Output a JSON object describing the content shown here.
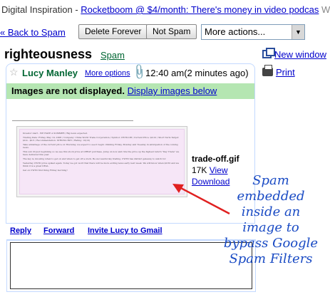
{
  "topbar": {
    "source": "Digital Inspiration",
    "separator": " - ",
    "link": "Rocketboom @ $4/month: There's money in video podcas",
    "tail": "W"
  },
  "toolbar": {
    "back": "« Back to Spam",
    "delete": "Delete Forever",
    "notspam": "Not Spam",
    "more_actions": "More actions..."
  },
  "subject": {
    "title": "righteousness",
    "label": "Spam",
    "new_window": "New window",
    "print": "Print"
  },
  "message": {
    "sender": "Lucy Manley",
    "more_options": "More options",
    "time": "12:40 am",
    "time_ago": "(2 minutes ago)",
    "warning": "Images are not displayed.",
    "display_images": "Display images below",
    "spam_image_lines": [
      "Investor Alert - WE HAVE A SUMMER / Big news expected.",
      "Trading Date: Friday, May 19, 2006 / Company: China World Trade Corporation / Symbol: CWTD.OB / Current Price: $0.22 / Short Term Target: $0.4 - $0.5 / Recommendation: STRONG BUY / Rating: 10(10)",
      "Take advantage of the current price on Thursday, we expect to see it begin climbing Friday, Monday and Tuesday in anticipation of the coming news.",
      "This sub 20 just beginning so we see this stock price at GREAT purchase. Jump on now and ride the price up the highest return \"Day Trade\" we have delivered this year.",
      "The key is, knowing when to get on and when to get off a stock. Be successful day trading. CWTD has distinct gateway to watch for.",
      "Yesterday CWTD price spiked again. Today we got word that there will be more exiting news early next week. We will know when $0.50 and we think it is a great DEAL.",
      "Get on CWTD first thing Friday morning!"
    ],
    "attachment": {
      "name": "trade-off.gif",
      "size": "17K",
      "view": "View",
      "download": "Download"
    }
  },
  "reply": {
    "reply": "Reply",
    "forward": "Forward",
    "invite": "Invite Lucy to Gmail"
  },
  "annotation": {
    "lines": [
      "Spam",
      "embedded",
      "inside an",
      "image to",
      "bypass Google",
      "Spam Filters"
    ],
    "color": "#1a4bc4",
    "arrow_color": "#e02020"
  }
}
